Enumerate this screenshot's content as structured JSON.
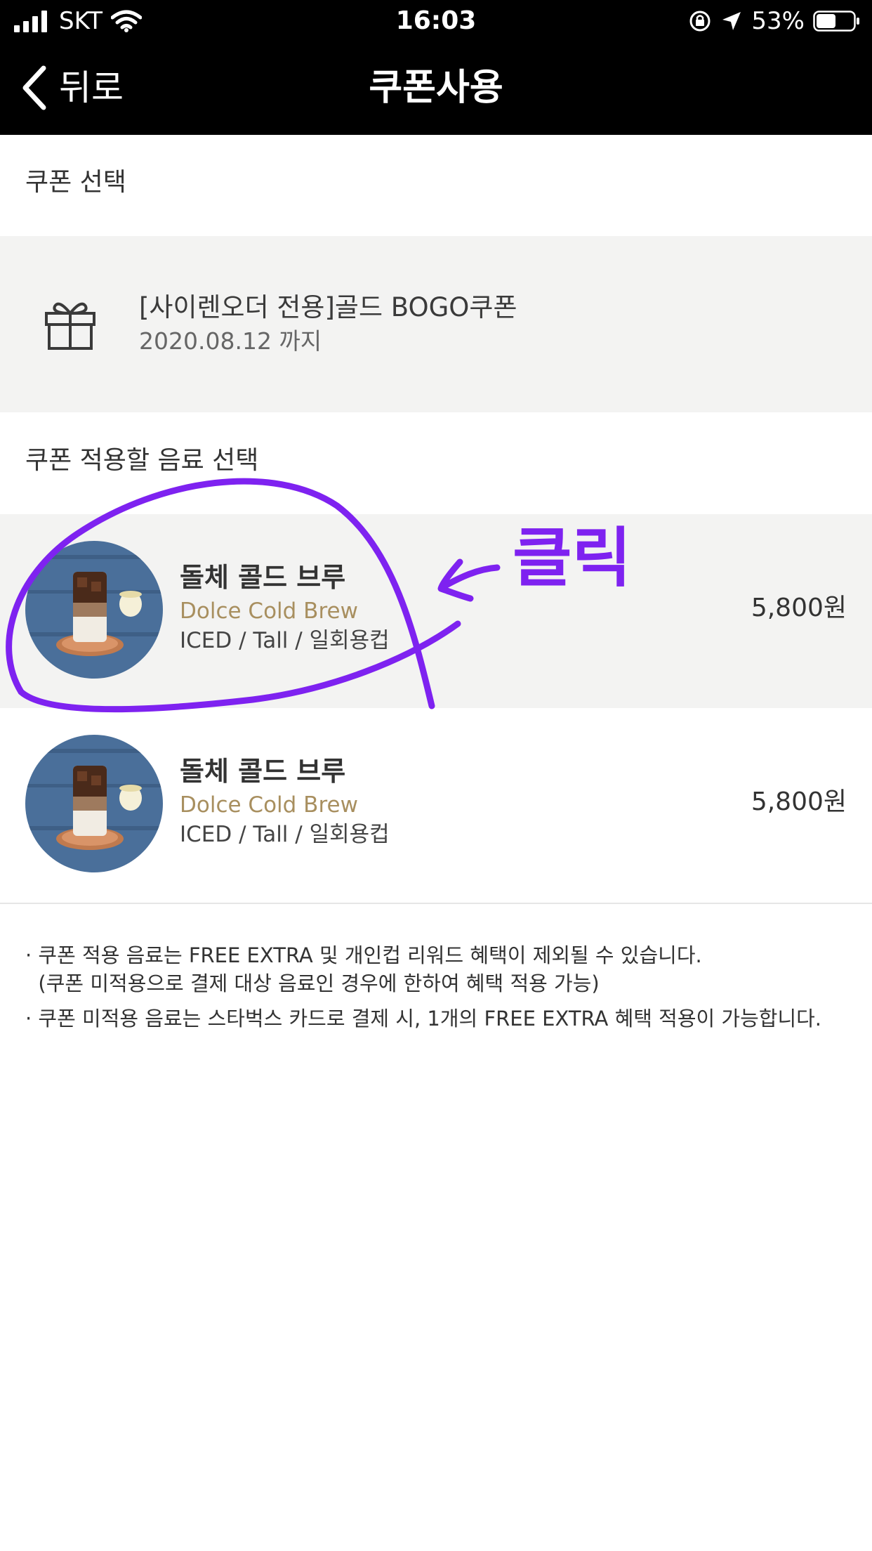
{
  "status_bar": {
    "carrier": "SKT",
    "time": "16:03",
    "battery_percent": "53%",
    "battery_level": 0.53
  },
  "nav": {
    "back_label": "뒤로",
    "title": "쿠폰사용"
  },
  "coupon_section": {
    "label": "쿠폰 선택",
    "coupon": {
      "icon": "gift-icon",
      "name": "[사이렌오더 전용]골드 BOGO쿠폰",
      "expiry": "2020.08.12 까지"
    }
  },
  "drink_section": {
    "label": "쿠폰 적용할 음료 선택",
    "items": [
      {
        "name_ko": "돌체 콜드 브루",
        "name_en": "Dolce Cold Brew",
        "options": "ICED / Tall / 일회용컵",
        "price": "5,800원",
        "selected": true
      },
      {
        "name_ko": "돌체 콜드 브루",
        "name_en": "Dolce Cold Brew",
        "options": "ICED / Tall / 일회용컵",
        "price": "5,800원",
        "selected": false
      }
    ]
  },
  "notes": [
    "· 쿠폰 적용 음료는 FREE EXTRA 및 개인컵 리워드 혜택이 제외될 수 있습니다.",
    "  (쿠폰 미적용으로 결제 대상 음료인 경우에 한하여 혜택 적용 가능)",
    "· 쿠폰 미적용 음료는 스타벅스 카드로 결제 시, 1개의 FREE EXTRA 혜택 적용이 가능합니다."
  ],
  "annotation": {
    "text": "클릭",
    "color": "#7e22f0"
  },
  "colors": {
    "header_bg": "#000000",
    "selected_row_bg": "#f3f3f2",
    "english_name": "#a88f5f"
  }
}
